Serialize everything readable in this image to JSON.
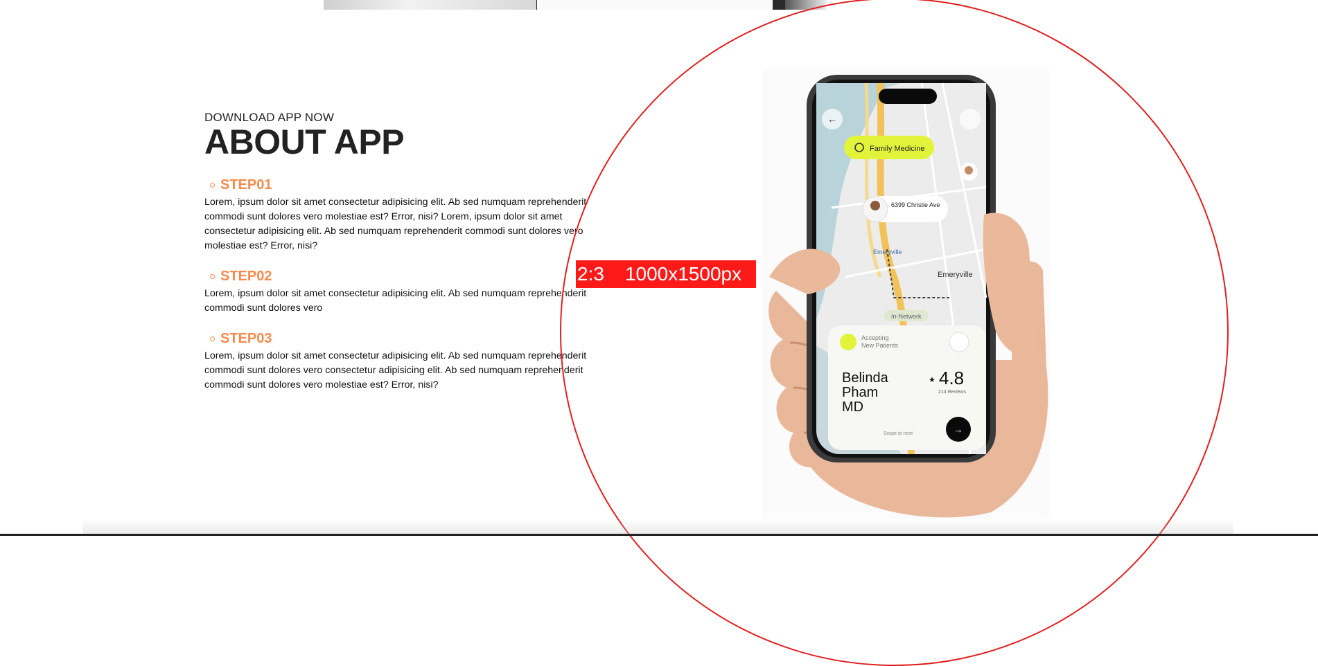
{
  "section": {
    "eyebrow": "DOWNLOAD APP NOW",
    "title": "ABOUT APP"
  },
  "steps": [
    {
      "label": "STEP01",
      "text": "Lorem, ipsum dolor sit amet consectetur adipisicing elit. Ab sed numquam reprehenderit commodi sunt dolores vero molestiae est? Error, nisi? Lorem, ipsum dolor sit amet consectetur adipisicing elit. Ab sed numquam reprehenderit commodi sunt dolores vero molestiae est? Error, nisi?"
    },
    {
      "label": "STEP02",
      "text": "Lorem, ipsum dolor sit amet consectetur adipisicing elit. Ab sed numquam reprehenderit commodi sunt dolores vero"
    },
    {
      "label": "STEP03",
      "text": "Lorem, ipsum dolor sit amet consectetur adipisicing elit. Ab sed numquam reprehenderit commodi sunt dolores vero consectetur adipisicing elit. Ab sed numquam reprehenderit commodi sunt dolores vero molestiae est? Error, nisi?"
    }
  ],
  "placeholder_badge": {
    "ratio": "2:3",
    "size": "1000x1500px"
  },
  "phone": {
    "search_chip": "Family Medicine",
    "address": "6399 Christie Ave",
    "map_labels": [
      "Emeryville",
      "Emeryville",
      "In-Network"
    ],
    "card_status_1": "Accepting",
    "card_status_2": "New Patients",
    "doctor_name_1": "Belinda",
    "doctor_name_2": "Pham",
    "doctor_name_3": "MD",
    "rating": "4.8",
    "reviews": "214 Reviews",
    "swipe": "Swipe to next"
  },
  "colors": {
    "accent": "#f58a4b",
    "circle": "#e02020",
    "badge": "#ff1a1a",
    "chip": "#e2f43a"
  }
}
